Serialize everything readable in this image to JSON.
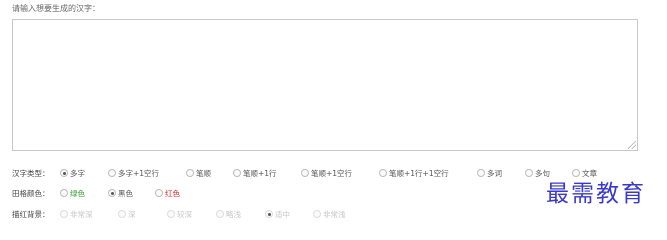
{
  "prompt_label": "请输入想要生成的汉字：",
  "char_type": {
    "label": "汉字类型：",
    "options": [
      "多字",
      "多字+1空行",
      "笔顺",
      "笔顺+1行",
      "笔顺+1空行",
      "笔顺+1行+1空行",
      "多词",
      "多句",
      "文章"
    ],
    "selected": 0
  },
  "grid_color": {
    "label": "田格颜色：",
    "options": [
      "绿色",
      "黑色",
      "红色"
    ],
    "option_colors": [
      "#2e9e2e",
      "#555555",
      "#d62828"
    ],
    "selected": 1
  },
  "trace_bg": {
    "label": "描红背景：",
    "options": [
      "非常深",
      "深",
      "较深",
      "略浅",
      "适中",
      "非常浅"
    ],
    "selected": 4
  },
  "watermark": "最需教育"
}
